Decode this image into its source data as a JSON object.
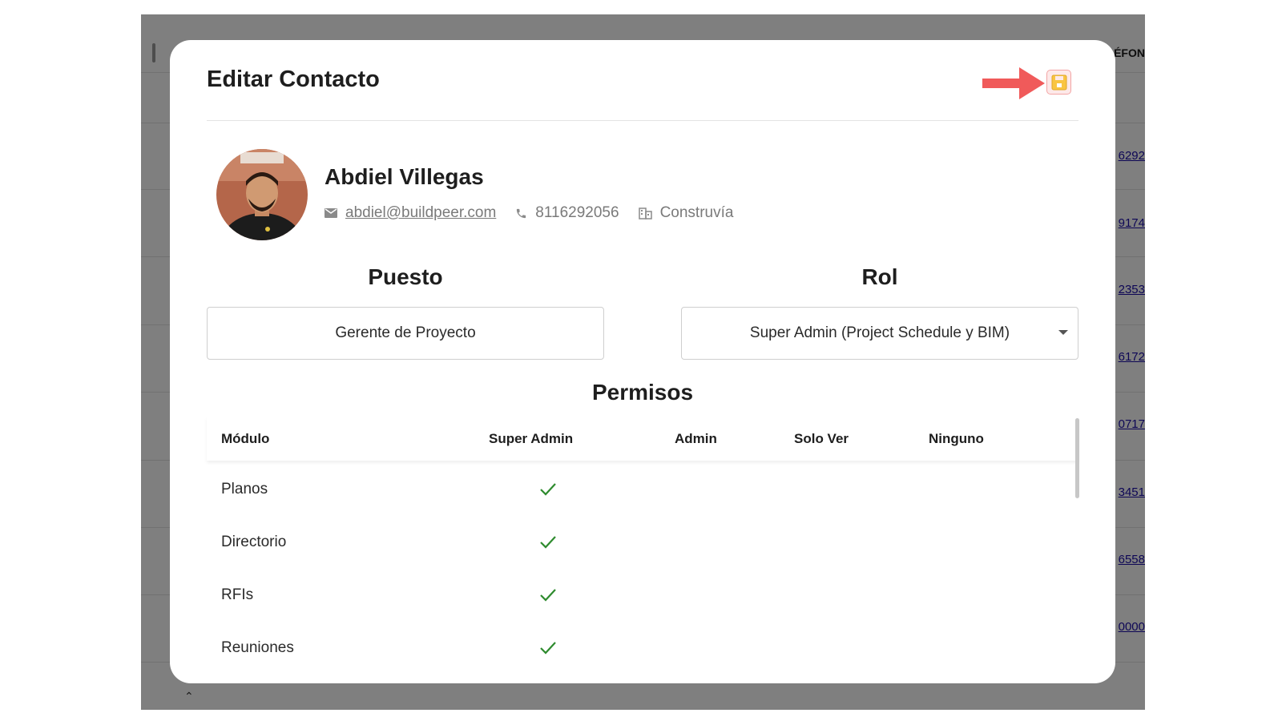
{
  "background": {
    "column_header": "LÉFON",
    "phones": [
      "6292",
      "9174",
      "2353",
      "6172",
      "0717",
      "3451",
      "6558",
      "0000"
    ]
  },
  "modal": {
    "title": "Editar Contacto",
    "save_icon": "save-icon",
    "save_color": "#f05a5a",
    "save_fill": "#f9c542"
  },
  "contact": {
    "name": "Abdiel Villegas",
    "email": "abdiel@buildpeer.com",
    "phone": "8116292056",
    "company": "Construvía",
    "icons": {
      "email": "mail-icon",
      "phone": "phone-icon",
      "company": "building-icon"
    }
  },
  "puesto": {
    "label": "Puesto",
    "value": "Gerente de Proyecto"
  },
  "rol": {
    "label": "Rol",
    "value": "Super Admin (Project Schedule y BIM)"
  },
  "permisos": {
    "title": "Permisos",
    "columns": [
      "Módulo",
      "Super Admin",
      "Admin",
      "Solo Ver",
      "Ninguno"
    ],
    "rows": [
      {
        "module": "Planos",
        "level": "Super Admin"
      },
      {
        "module": "Directorio",
        "level": "Super Admin"
      },
      {
        "module": "RFIs",
        "level": "Super Admin"
      },
      {
        "module": "Reuniones",
        "level": "Super Admin"
      }
    ],
    "check_color": "#2e8b2e"
  }
}
